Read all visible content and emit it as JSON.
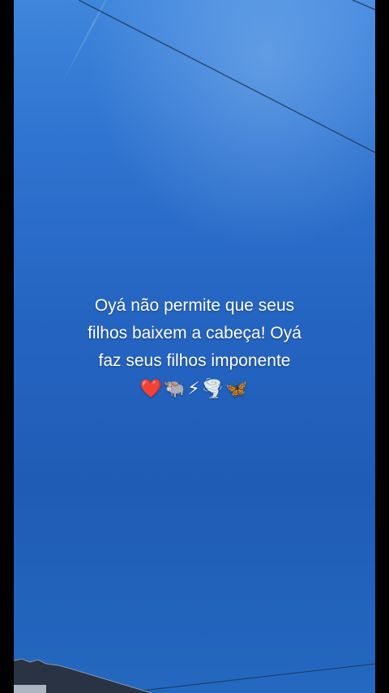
{
  "caption": {
    "line1": "Oyá não permite que seus",
    "line2": "filhos baixem a cabeça! Oyá",
    "line3": "faz seus filhos imponente",
    "emojis": "❤️🐃⚡🌪️🦋"
  },
  "colors": {
    "sky_top": "#3f86dc",
    "sky_bottom": "#1f5cb6",
    "text": "#ffffff",
    "letterbox": "#000000"
  }
}
